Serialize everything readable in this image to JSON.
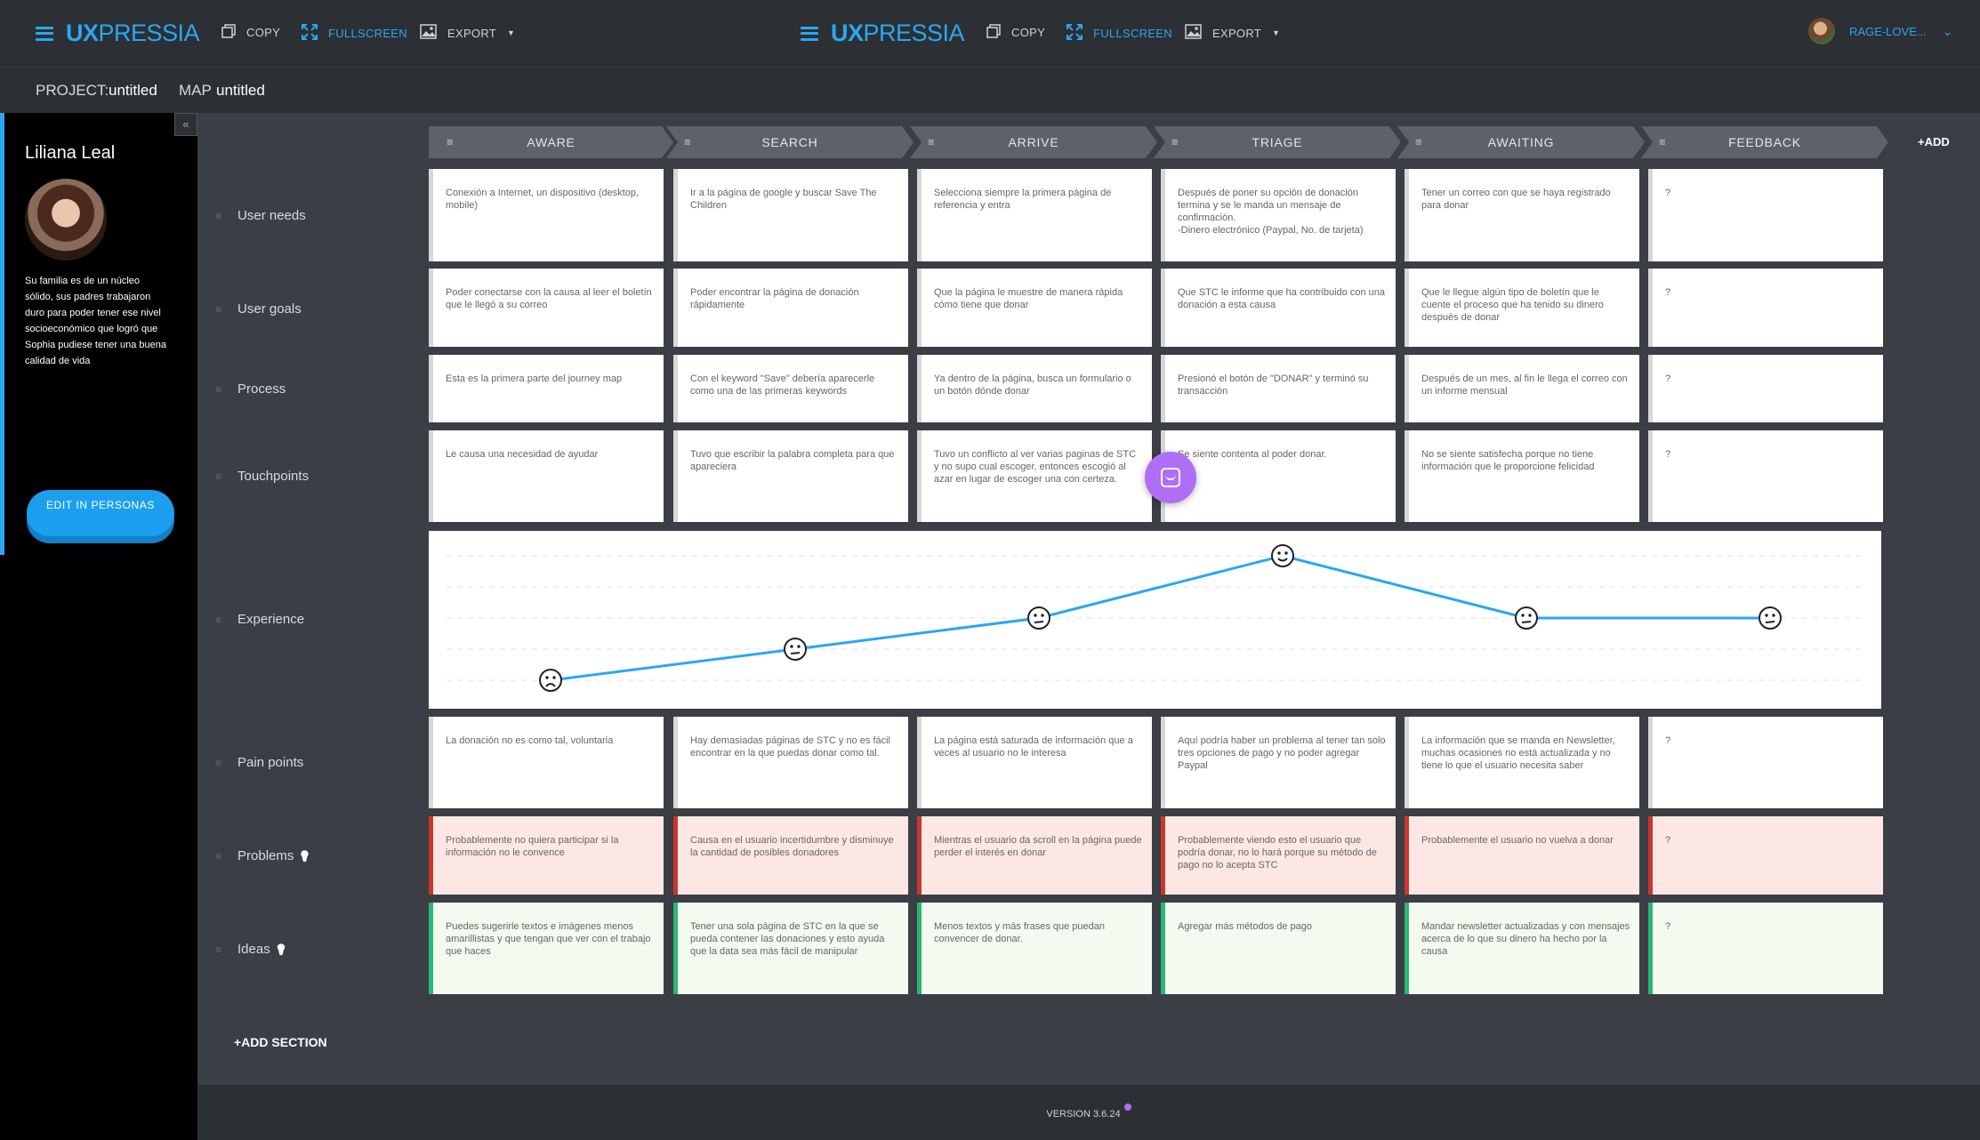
{
  "topbar": {
    "instances": [
      {
        "logo_a": "UX",
        "logo_b": "PRESSIA",
        "copy": "COPY",
        "fullscreen": "FULLSCREEN",
        "export": "EXPORT"
      },
      {
        "logo_a": "UX",
        "logo_b": "PRESSIA",
        "copy": "COPY",
        "fullscreen": "FULLSCREEN",
        "export": "EXPORT"
      }
    ],
    "user_name": "RAGE-LOVE..."
  },
  "project": {
    "project_label": "PROJECT:",
    "project_name": "untitled",
    "map_label": "MAP",
    "map_name": "untitled"
  },
  "persona": {
    "name": "Liliana Leal",
    "description": "Su familia es de un núcleo sólido, sus padres trabajaron duro para poder tener ese nivel socioeconómico que logró que Sophia pudiese tener una buena calidad de vida",
    "edit_button": "EDIT IN PERSONAS"
  },
  "phases": [
    "AWARE",
    "SEARCH",
    "ARRIVE",
    "TRIAGE",
    "AWAITING",
    "FEEDBACK"
  ],
  "add_phase": "+ADD",
  "rows": {
    "user_needs": {
      "label": "User needs",
      "cells": [
        "Conexión a Internet, un dispositivo (desktop, mobile)",
        "Ir a la página de google y buscar Save The Children",
        "Selecciona siempre la primera página de referencia y entra",
        "Después de poner su opción de donación termina y se le manda un mensaje de confirmación.\n-Dinero electrónico (Paypal, No. de tarjeta)",
        "Tener un correo con que se haya registrado para donar",
        "?"
      ]
    },
    "user_goals": {
      "label": "User goals",
      "cells": [
        "Poder conectarse con la causa al leer el boletín que le llegó a su correo",
        "Poder encontrar la página de donación rápidamente",
        "Que la página le muestre de manera rápida cómo tiene que donar",
        "Que STC le informe que ha contribuido con una donación a esta causa",
        "Que le llegue algún tipo de boletín que le cuente el proceso que ha tenido su dinero después de donar",
        "?"
      ]
    },
    "process": {
      "label": "Process",
      "cells": [
        "Esta es la primera parte del journey map",
        "Con el keyword \"Save\" debería aparecerle como una de las primeras keywords",
        "Ya dentro de la página, busca un formulario o un botón dónde donar",
        "Presionó el botón de \"DONAR\" y terminó su transacción",
        "Después de un mes, al fin le llega el correo con un informe mensual",
        "?"
      ]
    },
    "touchpoints": {
      "label": "Touchpoints",
      "cells": [
        "Le causa una necesidad de ayudar",
        "Tuvo que escribir la palabra completa para que apareciera",
        "Tuvo un conflicto al ver varias paginas de STC y no supo cual escoger, entonces escogió al azar en lugar de escoger una con certeza.",
        "Se siente contenta al poder donar.",
        "No se siente satisfecha porque no tiene información que le proporcione felicidad",
        "?"
      ]
    },
    "experience": {
      "label": "Experience",
      "levels": [
        1,
        2,
        3,
        5,
        3,
        3
      ],
      "faces": [
        "sad",
        "neutral",
        "neutral",
        "happy",
        "neutral",
        "neutral"
      ]
    },
    "pain_points": {
      "label": "Pain points",
      "cells": [
        "La donación no es como tal, voluntaria",
        "Hay demasiadas páginas de STC y no es fácil encontrar en la que puedas donar como tal.",
        "La página está saturada de información que a veces al usuario no le interesa",
        "Aquí podría haber un problema al tener tan solo tres opciones de pago y no poder agregar Paypal",
        "La información que se manda en Newsletter, muchas ocasiones no está actualizada y no tiene lo que el usuario necesita saber",
        "?"
      ]
    },
    "problems": {
      "label": "Problems",
      "cells": [
        "Probablemente no quiera participar si la información no le convence",
        "Causa en el usuario incertidumbre y disminuye la cantidad de posibles donadores",
        "Mientras el usuario da scroll en la página puede perder el interés en donar",
        "Probablemente viendo esto el usuario que podría donar, no lo hará porque su método de pago no lo acepta STC",
        "Probablemente el usuario no vuelva a donar",
        "?"
      ]
    },
    "ideas": {
      "label": "Ideas",
      "cells": [
        "Puedes sugerirle textos e imágenes menos amarillistas y que tengan que ver con el trabajo que haces",
        "Tener una sola página de STC en la que se pueda contener las donaciones y esto ayuda que la data sea más fácil de manipular",
        "Menos textos y más frases que puedan convencer de donar.",
        "Agregar más métodos de pago",
        "Mandar newsletter actualizadas y con mensajes acerca de lo que su dinero ha hecho por la causa",
        "?"
      ]
    }
  },
  "add_section": "+ADD SECTION",
  "footer": {
    "version": "VERSION 3.6.24"
  },
  "colors": {
    "accent": "#2aa7f2",
    "problem_border": "#c9372c",
    "idea_border": "#2bb673",
    "chat": "#b06ef7"
  }
}
